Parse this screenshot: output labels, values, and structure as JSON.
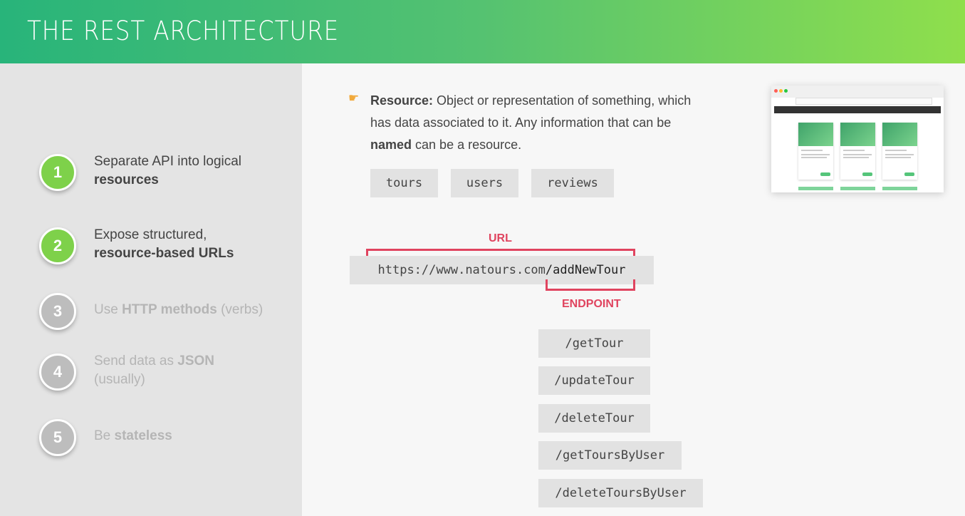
{
  "header": {
    "title": "THE REST ARCHITECTURE"
  },
  "steps": [
    {
      "number": "1",
      "line1": "Separate API into logical",
      "line2_bold": "resources"
    },
    {
      "number": "2",
      "line1": "Expose structured,",
      "line2_bold": "resource-based URLs"
    },
    {
      "number": "3",
      "pre": "Use ",
      "bold": "HTTP methods",
      "post": " (verbs)"
    },
    {
      "number": "4",
      "pre": "Send data as ",
      "bold": "JSON",
      "line2": "(usually)"
    },
    {
      "number": "5",
      "pre": "Be ",
      "bold": "stateless"
    }
  ],
  "resource": {
    "label": "Resource:",
    "text1": " Object or representation of something, which has data associated to it. Any information that can be ",
    "bold2": "named",
    "text2": " can be a resource."
  },
  "resource_chips": [
    "tours",
    "users",
    "reviews"
  ],
  "url": {
    "label": "URL",
    "base": "https://www.natours.com",
    "path": "/addNewTour",
    "endpoint_label": "ENDPOINT"
  },
  "endpoints": [
    "/getTour",
    "/updateTour",
    "/deleteTour",
    "/getToursByUser",
    "/deleteToursByUser"
  ],
  "colors": {
    "accent_green": "#7ed14a",
    "header_gradient": [
      "#28b47a",
      "#8fdf4c"
    ],
    "highlight_red": "#e0445f"
  },
  "icons": {
    "pointer": "hand-pointing-right-icon"
  }
}
